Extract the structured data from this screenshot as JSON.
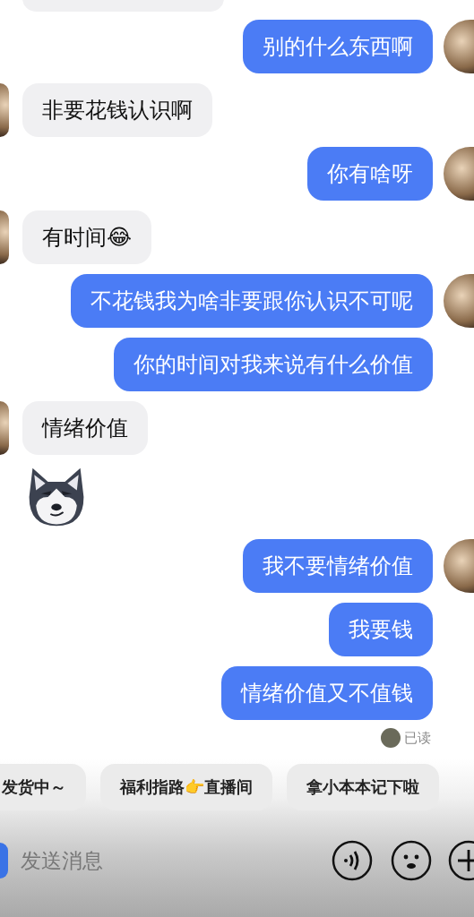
{
  "messages": [
    {
      "outgoing": true,
      "kind": "text",
      "text": "别的什么东西啊",
      "avatar": true
    },
    {
      "outgoing": false,
      "kind": "text",
      "text": "非要花钱认识啊",
      "avatar": true
    },
    {
      "outgoing": true,
      "kind": "text",
      "text": "你有啥呀",
      "avatar": true
    },
    {
      "outgoing": false,
      "kind": "text",
      "text": "有时间😂",
      "avatar": true
    },
    {
      "outgoing": true,
      "kind": "text",
      "text": "不花钱我为啥非要跟你认识不可呢",
      "avatar": true
    },
    {
      "outgoing": true,
      "kind": "text",
      "text": "你的时间对我来说有什么价值",
      "avatar": false
    },
    {
      "outgoing": false,
      "kind": "text",
      "text": "情绪价值",
      "avatar": true
    },
    {
      "outgoing": false,
      "kind": "sticker",
      "avatar": false
    },
    {
      "outgoing": true,
      "kind": "text",
      "text": "我不要情绪价值",
      "avatar": true
    },
    {
      "outgoing": true,
      "kind": "text",
      "text": "我要钱",
      "avatar": false
    },
    {
      "outgoing": true,
      "kind": "text",
      "text": "情绪价值又不值钱",
      "avatar": false
    }
  ],
  "read_receipt": "已读",
  "quick_replies": [
    "发货中～",
    "福利指路👉直播间",
    "拿小本本记下啦"
  ],
  "input": {
    "placeholder": "发送消息"
  }
}
